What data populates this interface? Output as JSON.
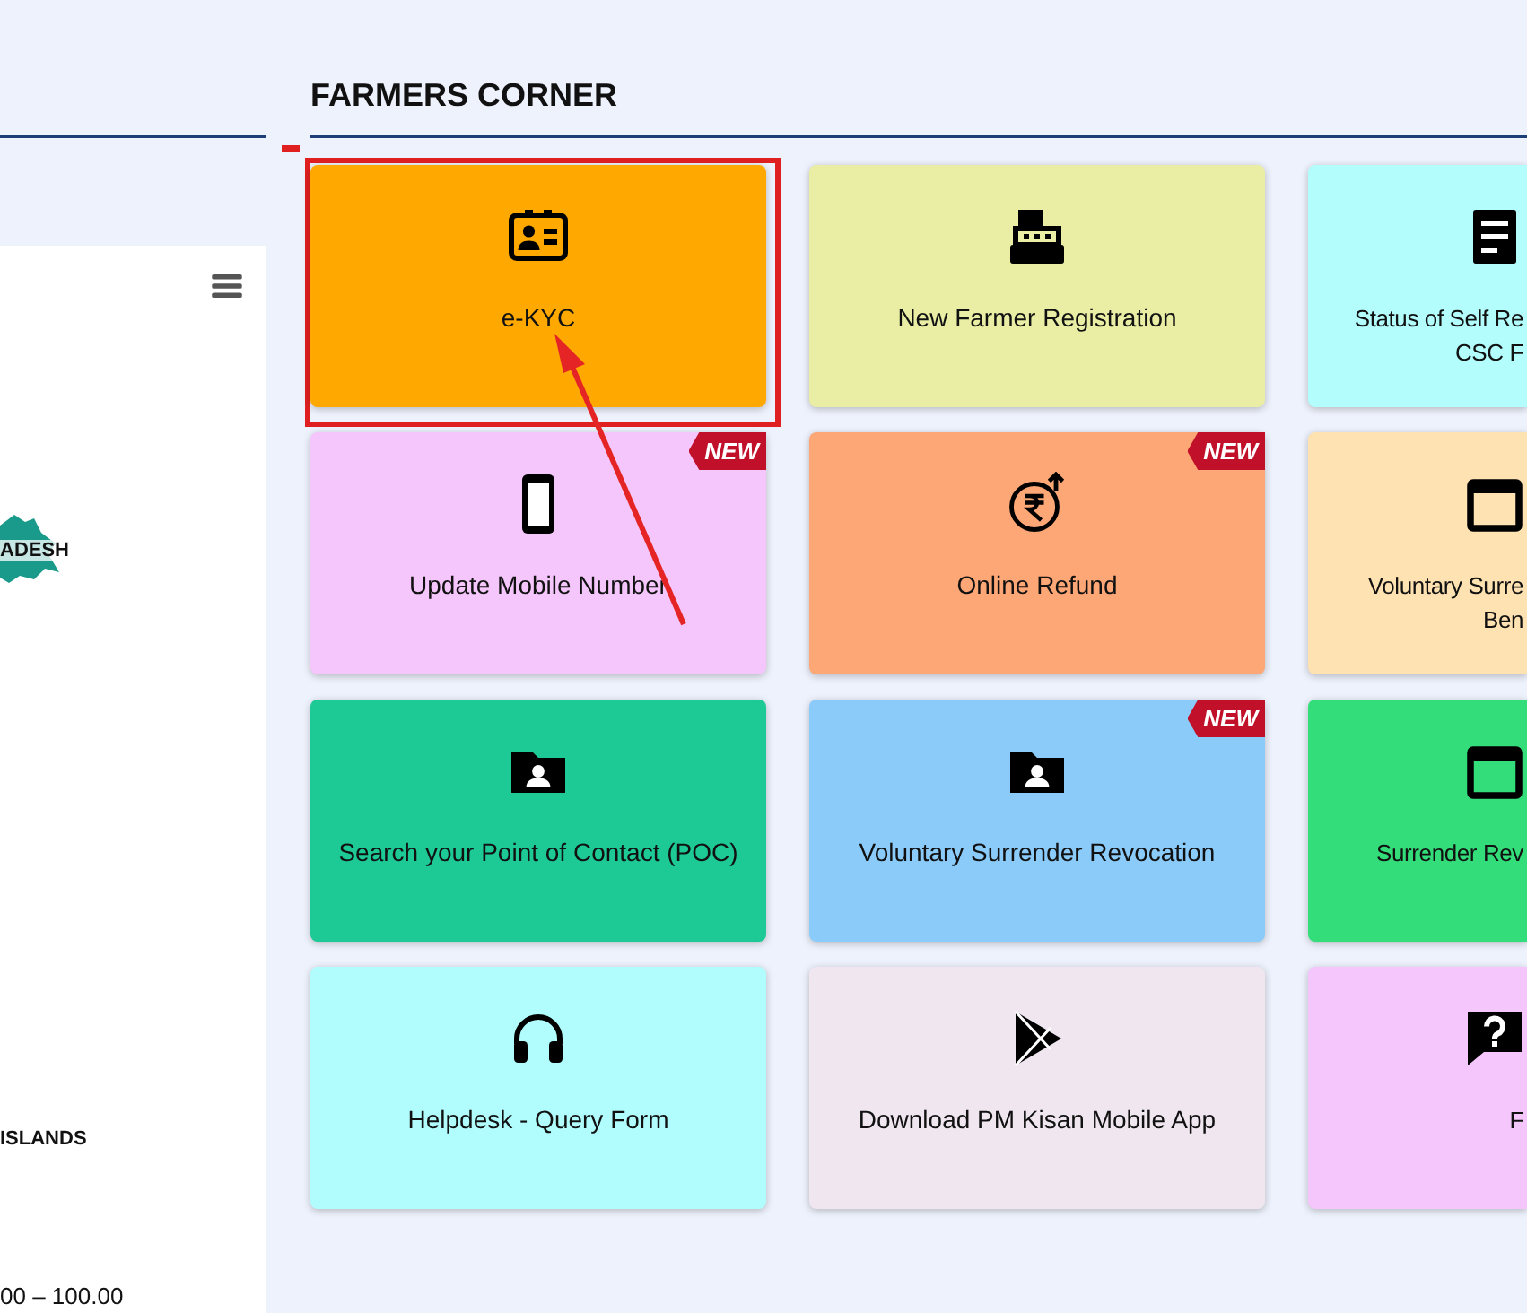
{
  "side_panel": {
    "logo_text": "ADESH",
    "list_label": "ISLANDS",
    "range": "00 – 100.00"
  },
  "section": {
    "title": "FARMERS CORNER"
  },
  "cards": [
    {
      "label": "e-KYC",
      "color": "#ffa800",
      "highlighted": true
    },
    {
      "label": "New Farmer Registration",
      "color": "#e9eea4",
      "highlighted": false
    },
    {
      "label": "Status of Self Re\nCSC F",
      "color": "#b3fdfd",
      "highlighted": false
    },
    {
      "label": "Update Mobile Number",
      "color": "#f5c6fb",
      "highlighted": false,
      "badge": "NEW"
    },
    {
      "label": "Online Refund",
      "color": "#fda676",
      "highlighted": false,
      "badge": "NEW"
    },
    {
      "label": "Voluntary Surre\nBen",
      "color": "#ffe2b1",
      "highlighted": false
    },
    {
      "label": "Search your Point of Contact (POC)",
      "color": "#1dca96",
      "highlighted": false
    },
    {
      "label": "Voluntary Surrender Revocation",
      "color": "#8bcbfa",
      "highlighted": false,
      "badge": "NEW"
    },
    {
      "label": "Surrender Rev",
      "color": "#33de7a",
      "highlighted": false
    },
    {
      "label": "Helpdesk - Query Form",
      "color": "#b1fdfd",
      "highlighted": false
    },
    {
      "label": "Download PM Kisan Mobile App",
      "color": "#efe6ef",
      "highlighted": false
    },
    {
      "label": "F",
      "color": "#f5c6fb",
      "highlighted": false
    }
  ]
}
